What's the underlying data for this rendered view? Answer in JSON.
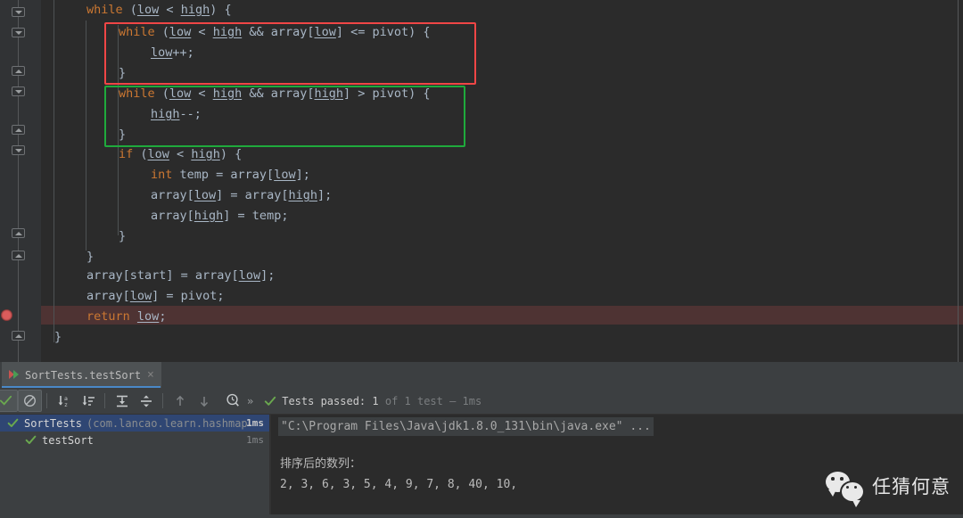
{
  "editor": {
    "theme_bg": "#2b2b2b",
    "gutter_bg": "#313335",
    "breakpoint_line_bg": "#4e3333",
    "lines": [
      {
        "indent": 2,
        "text": "while (low < high) {"
      },
      {
        "indent": 3,
        "text": "while (low < high && array[low] <= pivot) {"
      },
      {
        "indent": 4,
        "text": "low++;"
      },
      {
        "indent": 3,
        "text": "}"
      },
      {
        "indent": 3,
        "text": "while (low < high && array[high] > pivot) {"
      },
      {
        "indent": 4,
        "text": "high--;"
      },
      {
        "indent": 3,
        "text": "}"
      },
      {
        "indent": 3,
        "text": "if (low < high) {"
      },
      {
        "indent": 4,
        "text": "int temp = array[low];"
      },
      {
        "indent": 4,
        "text": "array[low] = array[high];"
      },
      {
        "indent": 4,
        "text": "array[high] = temp;"
      },
      {
        "indent": 3,
        "text": "}"
      },
      {
        "indent": 2,
        "text": "}"
      },
      {
        "indent": 2,
        "text": "array[start] = array[low];"
      },
      {
        "indent": 2,
        "text": "array[low] = pivot;"
      },
      {
        "indent": 2,
        "text": "return low;"
      },
      {
        "indent": 1,
        "text": "}"
      }
    ],
    "annotations": [
      {
        "name": "red-highlight-box",
        "color": "#f04646"
      },
      {
        "name": "green-highlight-box",
        "color": "#1faa3c"
      }
    ]
  },
  "panel": {
    "tab": {
      "label": "SortTests.testSort",
      "close_glyph": "×",
      "run_icon": "run-configuration-icon"
    },
    "toolbar": {
      "buttons": [
        {
          "name": "show-passed-toggle",
          "icon": "check-icon",
          "pressed": true
        },
        {
          "name": "hide-ignored-toggle",
          "icon": "circle-slash-icon",
          "pressed": true
        },
        {
          "name": "sort-alphabetically",
          "icon": "sort-alpha-icon",
          "pressed": false
        },
        {
          "name": "sort-by-duration",
          "icon": "sort-duration-icon",
          "pressed": false
        },
        {
          "name": "expand-all",
          "icon": "expand-all-icon",
          "pressed": false
        },
        {
          "name": "collapse-all",
          "icon": "collapse-all-icon",
          "pressed": false
        },
        {
          "name": "previous-failed-test",
          "icon": "arrow-up-icon",
          "pressed": false
        },
        {
          "name": "next-failed-test",
          "icon": "arrow-down-icon",
          "pressed": false
        },
        {
          "name": "test-history",
          "icon": "clock-search-icon",
          "pressed": false
        }
      ],
      "overflow_glyph": "»"
    },
    "status": {
      "check_glyph": "✔",
      "primary": "Tests passed: ",
      "count": "1",
      "secondary": " of 1 test – ",
      "duration": "1ms"
    },
    "tree": {
      "rows": [
        {
          "name": "SortTests",
          "package": "(com.lancao.learn.hashmap",
          "duration": "1ms",
          "selected": true,
          "indent": 0,
          "status": "passed"
        },
        {
          "name": "testSort",
          "package": "",
          "duration": "1ms",
          "selected": false,
          "indent": 1,
          "status": "passed"
        }
      ]
    },
    "console": {
      "command": "\"C:\\Program Files\\Java\\jdk1.8.0_131\\bin\\java.exe\" ...",
      "output_title": "排序后的数列：",
      "output_values": "2, 3, 6, 3, 5, 4, 9, 7, 8, 40, 10,"
    }
  },
  "watermark": {
    "text": "任猜何意",
    "icon": "wechat-logo-icon"
  },
  "colors": {
    "keyword": "#cc7832",
    "text": "#a9b7c6",
    "accent_blue": "#4a88c7",
    "pass_green": "#499c54",
    "breakpoint_red": "#db5c5c"
  }
}
